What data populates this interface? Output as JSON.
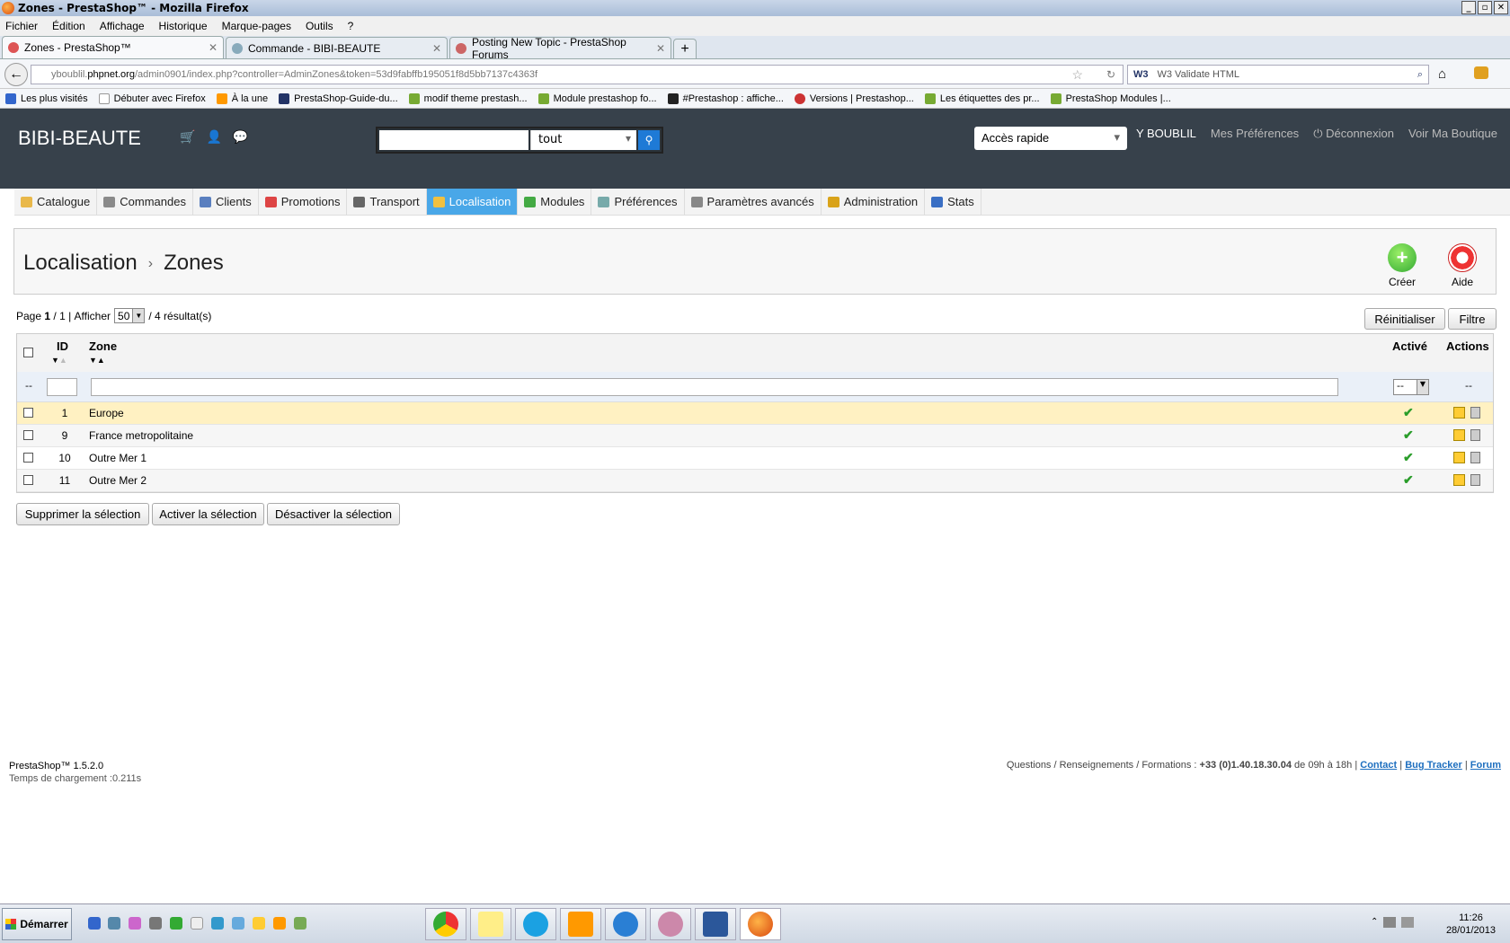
{
  "window": {
    "title": "Zones - PrestaShop™ - Mozilla Firefox"
  },
  "menu": [
    "Fichier",
    "Édition",
    "Affichage",
    "Historique",
    "Marque-pages",
    "Outils",
    "?"
  ],
  "tabs": [
    {
      "label": "Zones - PrestaShop™",
      "active": true
    },
    {
      "label": "Commande - BIBI-BEAUTE",
      "active": false
    },
    {
      "label": "Posting New Topic - PrestaShop Forums",
      "active": false
    }
  ],
  "new_tab_label": "+",
  "url": {
    "pre": "yboublil.",
    "domain": "phpnet.org",
    "path": "/admin0901/index.php?controller=AdminZones&token=53d9fabffb195051f8d5bb7137c4363f"
  },
  "browser_search": {
    "engine": "W3",
    "placeholder": "W3 Validate HTML"
  },
  "bookmarks": [
    "Les plus visités",
    "Débuter avec Firefox",
    "À la une",
    "PrestaShop-Guide-du...",
    "modif theme prestash...",
    "Module prestashop fo...",
    "#Prestashop : affiche...",
    "Versions | Prestashop...",
    "Les étiquettes des pr...",
    "PrestaShop Modules |..."
  ],
  "header": {
    "shop_name": "BIBI-BEAUTE",
    "search_scope": "tout",
    "quick_access": "Accès rapide",
    "user": "Y BOUBLIL",
    "preferences": "Mes Préférences",
    "logout": "Déconnexion",
    "view_shop": "Voir Ma Boutique"
  },
  "main_menu": [
    {
      "label": "Catalogue",
      "color": "#e9b84a"
    },
    {
      "label": "Commandes",
      "color": "#8a8a8a"
    },
    {
      "label": "Clients",
      "color": "#5a7fbf"
    },
    {
      "label": "Promotions",
      "color": "#d44"
    },
    {
      "label": "Transport",
      "color": "#666"
    },
    {
      "label": "Localisation",
      "color": "#f0c040",
      "active": true
    },
    {
      "label": "Modules",
      "color": "#4a4"
    },
    {
      "label": "Préférences",
      "color": "#7aa"
    },
    {
      "label": "Paramètres avancés",
      "color": "#888"
    },
    {
      "label": "Administration",
      "color": "#d9a31a"
    },
    {
      "label": "Stats",
      "color": "#3a6fc4"
    }
  ],
  "breadcrumb": {
    "parent": "Localisation",
    "sep": "›",
    "current": "Zones"
  },
  "toolbar": {
    "create_label": "Créer",
    "help_label": "Aide"
  },
  "list": {
    "page_label": "Page",
    "page": "1",
    "pages": "/ 1 |",
    "show_label": "Afficher",
    "per_page": "50",
    "results": "/ 4 résultat(s)",
    "reset_label": "Réinitialiser",
    "filter_label": "Filtre",
    "columns": {
      "id": "ID",
      "zone": "Zone",
      "active": "Activé",
      "actions": "Actions"
    },
    "filter_dash": "--",
    "rows": [
      {
        "id": "1",
        "zone": "Europe",
        "active": "✔"
      },
      {
        "id": "9",
        "zone": "France metropolitaine",
        "active": "✔"
      },
      {
        "id": "10",
        "zone": "Outre Mer 1",
        "active": "✔"
      },
      {
        "id": "11",
        "zone": "Outre Mer 2",
        "active": "✔"
      }
    ]
  },
  "bulk": {
    "delete": "Supprimer la sélection",
    "enable": "Activer la sélection",
    "disable": "Désactiver la sélection"
  },
  "footer": {
    "version": "PrestaShop™ 1.5.2.0",
    "load_time": "Temps de chargement :0.211s",
    "info": "Questions / Renseignements / Formations :",
    "phone": "+33 (0)1.40.18.30.04",
    "hours": "de 09h à 18h |",
    "contact": "Contact",
    "bugtracker": "Bug Tracker",
    "forum": "Forum",
    "sep": "|"
  },
  "taskbar": {
    "start": "Démarrer",
    "time": "11:26",
    "date": "28/01/2013"
  },
  "window_controls": [
    "_",
    "▫",
    "✕"
  ]
}
